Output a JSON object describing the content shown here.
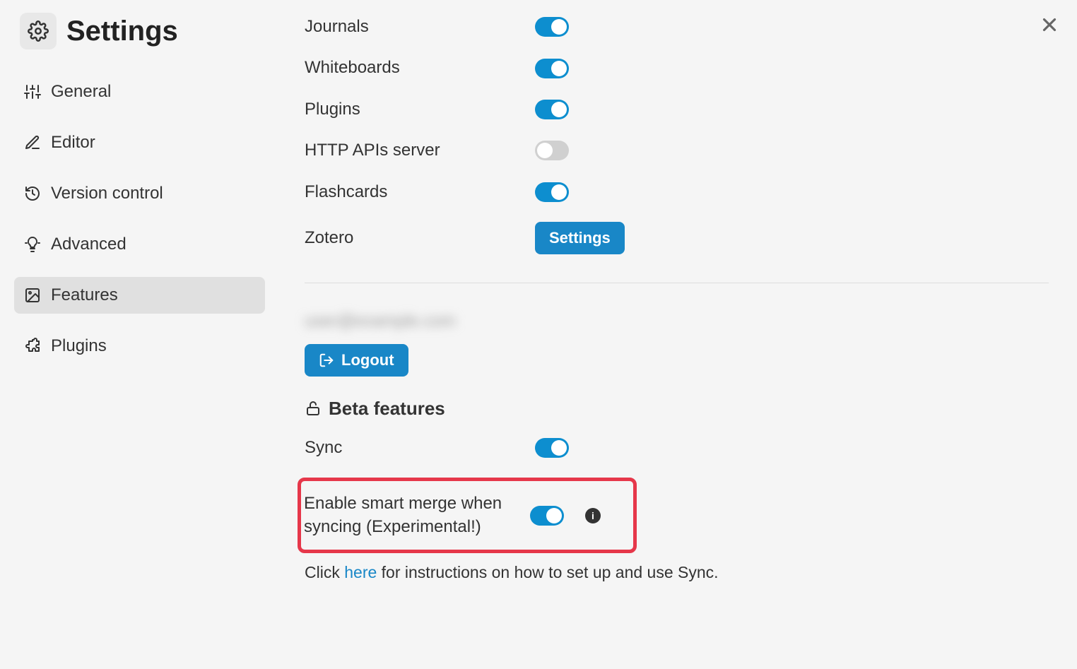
{
  "sidebar": {
    "title": "Settings",
    "items": [
      {
        "label": "General"
      },
      {
        "label": "Editor"
      },
      {
        "label": "Version control"
      },
      {
        "label": "Advanced"
      },
      {
        "label": "Features"
      },
      {
        "label": "Plugins"
      }
    ]
  },
  "features": {
    "rows": [
      {
        "label": "Journals",
        "on": true
      },
      {
        "label": "Whiteboards",
        "on": true
      },
      {
        "label": "Plugins",
        "on": true
      },
      {
        "label": "HTTP APIs server",
        "on": false
      },
      {
        "label": "Flashcards",
        "on": true
      }
    ],
    "zotero_label": "Zotero",
    "zotero_button": "Settings"
  },
  "account": {
    "email_masked": "user@example.com",
    "logout_label": "Logout"
  },
  "beta": {
    "title": "Beta features",
    "sync_label": "Sync",
    "sync_on": true,
    "smart_merge_label": "Enable smart merge when syncing (Experimental!)",
    "smart_merge_on": true,
    "instructions_prefix": "Click ",
    "instructions_link": "here",
    "instructions_suffix": " for instructions on how to set up and use Sync."
  }
}
